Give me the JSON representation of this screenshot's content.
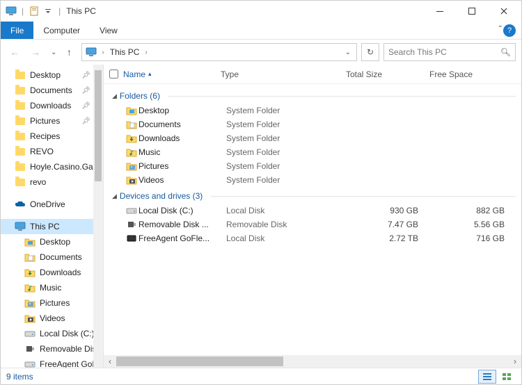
{
  "window": {
    "title": "This PC"
  },
  "menu": {
    "file": "File",
    "home": "Computer",
    "view": "View"
  },
  "address": {
    "location": "This PC"
  },
  "search": {
    "placeholder": "Search This PC"
  },
  "columns": {
    "name": "Name",
    "type": "Type",
    "total": "Total Size",
    "free": "Free Space"
  },
  "nav": {
    "quick": [
      {
        "label": "Desktop",
        "pinned": true
      },
      {
        "label": "Documents",
        "pinned": true
      },
      {
        "label": "Downloads",
        "pinned": true
      },
      {
        "label": "Pictures",
        "pinned": true
      },
      {
        "label": "Recipes",
        "pinned": false
      },
      {
        "label": "REVO",
        "pinned": false
      },
      {
        "label": "Hoyle.Casino.Ga",
        "pinned": false
      },
      {
        "label": "revo",
        "pinned": false
      }
    ],
    "onedrive": "OneDrive",
    "thispc": "This PC",
    "pcchildren": [
      {
        "label": "Desktop",
        "icon": "folder"
      },
      {
        "label": "Documents",
        "icon": "folder"
      },
      {
        "label": "Downloads",
        "icon": "folder"
      },
      {
        "label": "Music",
        "icon": "folder"
      },
      {
        "label": "Pictures",
        "icon": "folder"
      },
      {
        "label": "Videos",
        "icon": "folder"
      },
      {
        "label": "Local Disk (C:)",
        "icon": "disk"
      },
      {
        "label": "Removable Disk",
        "icon": "usb"
      },
      {
        "label": "FreeAgent GoFle",
        "icon": "disk"
      }
    ]
  },
  "groups": {
    "folders": {
      "title": "Folders (6)",
      "items": [
        {
          "name": "Desktop",
          "type": "System Folder"
        },
        {
          "name": "Documents",
          "type": "System Folder"
        },
        {
          "name": "Downloads",
          "type": "System Folder"
        },
        {
          "name": "Music",
          "type": "System Folder"
        },
        {
          "name": "Pictures",
          "type": "System Folder"
        },
        {
          "name": "Videos",
          "type": "System Folder"
        }
      ]
    },
    "drives": {
      "title": "Devices and drives (3)",
      "items": [
        {
          "name": "Local Disk (C:)",
          "type": "Local Disk",
          "total": "930 GB",
          "free": "882 GB",
          "icon": "disk"
        },
        {
          "name": "Removable Disk ...",
          "type": "Removable Disk",
          "total": "7.47 GB",
          "free": "5.56 GB",
          "icon": "usb"
        },
        {
          "name": "FreeAgent GoFle...",
          "type": "Local Disk",
          "total": "2.72 TB",
          "free": "716 GB",
          "icon": "ext"
        }
      ]
    }
  },
  "status": {
    "text": "9 items"
  }
}
